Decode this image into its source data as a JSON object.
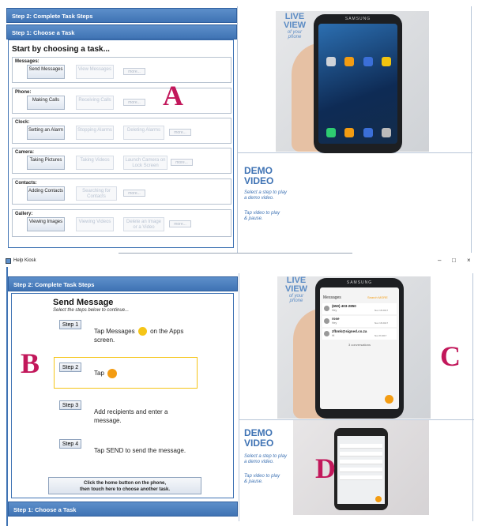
{
  "top": {
    "header_step2": "Step 2: Complete Task Steps",
    "header_step1": "Step 1: Choose a Task",
    "heading": "Start by choosing a task...",
    "sections": [
      {
        "title": "Messages:",
        "buttons": [
          {
            "label": "Send Messages",
            "enabled": true
          },
          {
            "label": "View Messages",
            "enabled": false
          }
        ],
        "more": "more..."
      },
      {
        "title": "Phone:",
        "buttons": [
          {
            "label": "Making Calls",
            "enabled": true
          },
          {
            "label": "Receiving Calls",
            "enabled": false
          }
        ],
        "more": "more..."
      },
      {
        "title": "Clock:",
        "buttons": [
          {
            "label": "Setting an Alarm",
            "enabled": true
          },
          {
            "label": "Stopping Alarms",
            "enabled": false
          },
          {
            "label": "Deleting Alarms",
            "enabled": false
          }
        ],
        "more": "more..."
      },
      {
        "title": "Camera:",
        "buttons": [
          {
            "label": "Taking Pictures",
            "enabled": true
          },
          {
            "label": "Taking Videos",
            "enabled": false
          },
          {
            "label": "Launch Camera on Lock Screen",
            "enabled": false
          }
        ],
        "more": "more..."
      },
      {
        "title": "Contacts:",
        "buttons": [
          {
            "label": "Adding Contacts",
            "enabled": true
          },
          {
            "label": "Searching for Contacts",
            "enabled": false
          }
        ],
        "more": "more..."
      },
      {
        "title": "Gallery:",
        "buttons": [
          {
            "label": "Viewing Images",
            "enabled": true
          },
          {
            "label": "Viewing Videos",
            "enabled": false
          },
          {
            "label": "Delete an Image or a Video",
            "enabled": false
          }
        ],
        "more": "more..."
      }
    ],
    "letter": "A",
    "live": {
      "line1": "LIVE",
      "line2": "VIEW",
      "sub1": "of your",
      "sub2": "phone"
    },
    "phone_brand": "SAMSUNG",
    "demo": {
      "title1": "DEMO",
      "title2": "VIDEO",
      "text1": "Select a step to play a demo video.",
      "text2": "Tap video to play & pause."
    }
  },
  "bottom": {
    "window_title": "Help Kiosk",
    "win_controls": [
      "–",
      "□",
      "×"
    ],
    "header_step2": "Step 2: Complete Task Steps",
    "header_step1": "Step 1: Choose a Task",
    "title": "Send Message",
    "subtitle": "Select the steps below to continue...",
    "steps": [
      {
        "label": "Step 1",
        "text": "Tap Messages",
        "text2": "on the Apps screen."
      },
      {
        "label": "Step 2",
        "text": "Tap"
      },
      {
        "label": "Step 3",
        "text": "Add recipients and enter a message."
      },
      {
        "label": "Step 4",
        "text": "Tap SEND to send the message."
      }
    ],
    "home_button": {
      "line1": "Click the home button on the phone,",
      "line2": "then touch here to choose another task."
    },
    "letters": {
      "b": "B",
      "c": "C",
      "d": "D"
    },
    "live": {
      "line1": "LIVE",
      "line2": "VIEW",
      "sub1": "of your",
      "sub2": "phone"
    },
    "phone_brand": "SAMSUNG",
    "messages_screen": {
      "title": "Messages",
      "actions": "Search   MORE",
      "items": [
        {
          "name": "(650) 403-2850",
          "sub": "Hey",
          "time": "Nov 18 2017"
        },
        {
          "name": "rose",
          "sub": "Hey",
          "time": "Nov 18 2017"
        },
        {
          "name": "zfbmk@signed.co.za",
          "sub": "Hi",
          "time": "Nov 8 2017"
        }
      ],
      "footer": "3 conversations"
    },
    "demo": {
      "title1": "DEMO",
      "title2": "VIDEO",
      "text1": "Select a step to play a demo video.",
      "text2": "Tap video to play & pause."
    }
  },
  "colors": {
    "bar": "#4a80c0",
    "accent": "#c2185b",
    "highlight": "#f5c518",
    "orange": "#f39c12"
  }
}
